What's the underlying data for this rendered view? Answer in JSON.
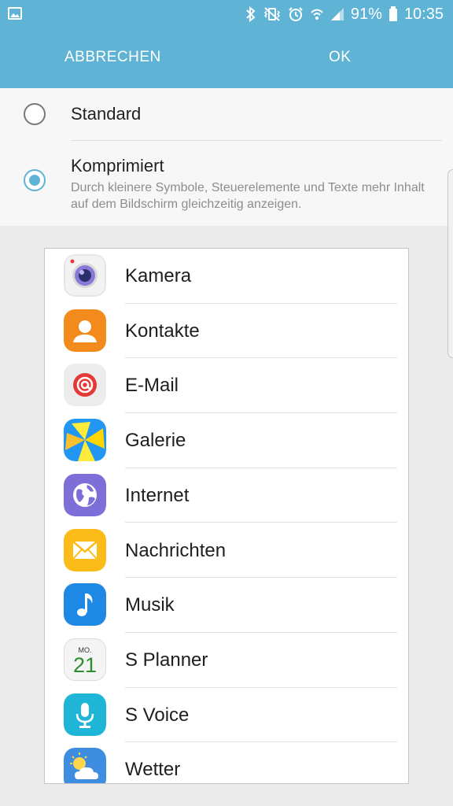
{
  "status_bar": {
    "left_icon": "image-notification-icon",
    "icons": [
      "bluetooth-icon",
      "vibrate-icon",
      "alarm-icon",
      "wifi-icon",
      "signal-icon"
    ],
    "battery_percent": "91%",
    "battery_icon": "battery-icon",
    "time": "10:35"
  },
  "action_bar": {
    "cancel_label": "ABBRECHEN",
    "ok_label": "OK",
    "color": "#5fb3d5"
  },
  "options": [
    {
      "title": "Standard",
      "selected": false
    },
    {
      "title": "Komprimiert",
      "description": "Durch kleinere Symbole, Steuerelemente und Texte mehr Inhalt auf dem Bildschirm gleichzeitig anzeigen.",
      "selected": true
    }
  ],
  "apps": [
    {
      "label": "Kamera",
      "icon": "camera-icon"
    },
    {
      "label": "Kontakte",
      "icon": "contacts-icon"
    },
    {
      "label": "E-Mail",
      "icon": "email-icon"
    },
    {
      "label": "Galerie",
      "icon": "gallery-icon"
    },
    {
      "label": "Internet",
      "icon": "internet-icon"
    },
    {
      "label": "Nachrichten",
      "icon": "messages-icon"
    },
    {
      "label": "Musik",
      "icon": "music-icon"
    },
    {
      "label": "S Planner",
      "icon": "calendar-icon",
      "calendar_day_label": "MO.",
      "calendar_date": "21"
    },
    {
      "label": "S Voice",
      "icon": "microphone-icon"
    },
    {
      "label": "Wetter",
      "icon": "weather-icon"
    }
  ]
}
